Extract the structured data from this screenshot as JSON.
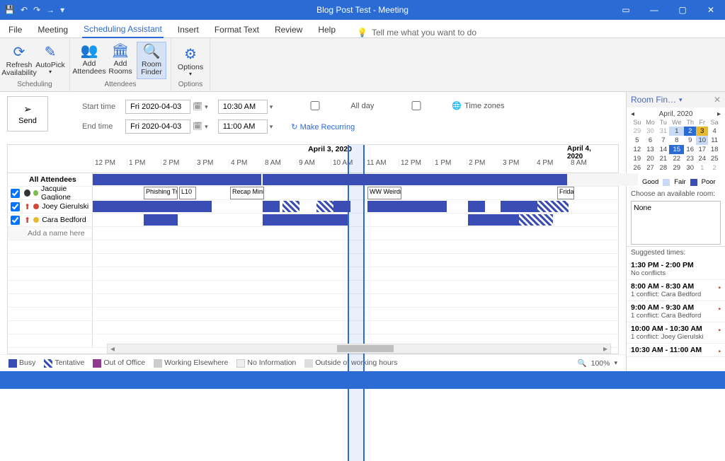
{
  "titlebar": {
    "title": "Blog Post Test  -  Meeting"
  },
  "tabs": [
    "File",
    "Meeting",
    "Scheduling Assistant",
    "Insert",
    "Format Text",
    "Review",
    "Help"
  ],
  "tellme": "Tell me what you want to do",
  "ribbon": {
    "scheduling": {
      "label": "Scheduling",
      "refresh": "Refresh Availability",
      "autopick": "AutoPick"
    },
    "attendees": {
      "label": "Attendees",
      "add_attendees": "Add Attendees",
      "add_rooms": "Add Rooms",
      "room_finder": "Room Finder"
    },
    "options": {
      "label": "Options",
      "options": "Options"
    }
  },
  "send": "Send",
  "time": {
    "start_label": "Start time",
    "end_label": "End time",
    "start_date": "Fri 2020-04-03",
    "end_date": "Fri 2020-04-03",
    "start_time": "10:30 AM",
    "end_time": "11:00 AM",
    "all_day": "All day",
    "time_zones": "Time zones",
    "make_recurring": "Make Recurring"
  },
  "grid": {
    "day1": "April 3, 2020",
    "day2": "April 4, 2020",
    "hours": [
      "12 PM",
      "1 PM",
      "2 PM",
      "3 PM",
      "4 PM",
      "8 AM",
      "9 AM",
      "10 AM",
      "11 AM",
      "12 PM",
      "1 PM",
      "2 PM",
      "3 PM",
      "4 PM",
      "8 AM"
    ],
    "all_attendees": "All Attendees",
    "add_placeholder": "Add a name here",
    "rows": [
      {
        "name": "Jacquie Gaglione",
        "role": "organizer"
      },
      {
        "name": "Joey Gierulski",
        "role": "required"
      },
      {
        "name": "Cara Bedford",
        "role": "required"
      }
    ],
    "events": {
      "phishing": "Phishing Tr.",
      "l10": "L10",
      "recap": "Recap Mini",
      "ww": "WW Weirdn",
      "frida": "Frida"
    }
  },
  "legend": {
    "busy": "Busy",
    "tentative": "Tentative",
    "ooo": "Out of Office",
    "elsewhere": "Working Elsewhere",
    "noinfo": "No Information",
    "outside": "Outside of working hours",
    "zoom": "100%"
  },
  "roomfinder": {
    "title": "Room Fin…",
    "month": "April, 2020",
    "dow": [
      "Su",
      "Mo",
      "Tu",
      "We",
      "Th",
      "Fr",
      "Sa"
    ],
    "weeks": [
      [
        "29",
        "30",
        "31",
        "1",
        "2",
        "3",
        "4"
      ],
      [
        "5",
        "6",
        "7",
        "8",
        "9",
        "10",
        "11"
      ],
      [
        "12",
        "13",
        "14",
        "15",
        "16",
        "17",
        "18"
      ],
      [
        "19",
        "20",
        "21",
        "22",
        "23",
        "24",
        "25"
      ],
      [
        "26",
        "27",
        "28",
        "29",
        "30",
        "1",
        "2"
      ]
    ],
    "key": {
      "good": "Good",
      "fair": "Fair",
      "poor": "Poor"
    },
    "choose": "Choose an available room:",
    "none": "None",
    "sugg_hdr": "Suggested times:",
    "slots": [
      {
        "time": "1:30 PM - 2:00 PM",
        "conf": "No conflicts"
      },
      {
        "time": "8:00 AM - 8:30 AM",
        "conf": "1 conflict: Cara Bedford"
      },
      {
        "time": "9:00 AM - 9:30 AM",
        "conf": "1 conflict: Cara Bedford"
      },
      {
        "time": "10:00 AM - 10:30 AM",
        "conf": "1 conflict: Joey Gierulski"
      },
      {
        "time": "10:30 AM - 11:00 AM",
        "conf": ""
      }
    ]
  }
}
